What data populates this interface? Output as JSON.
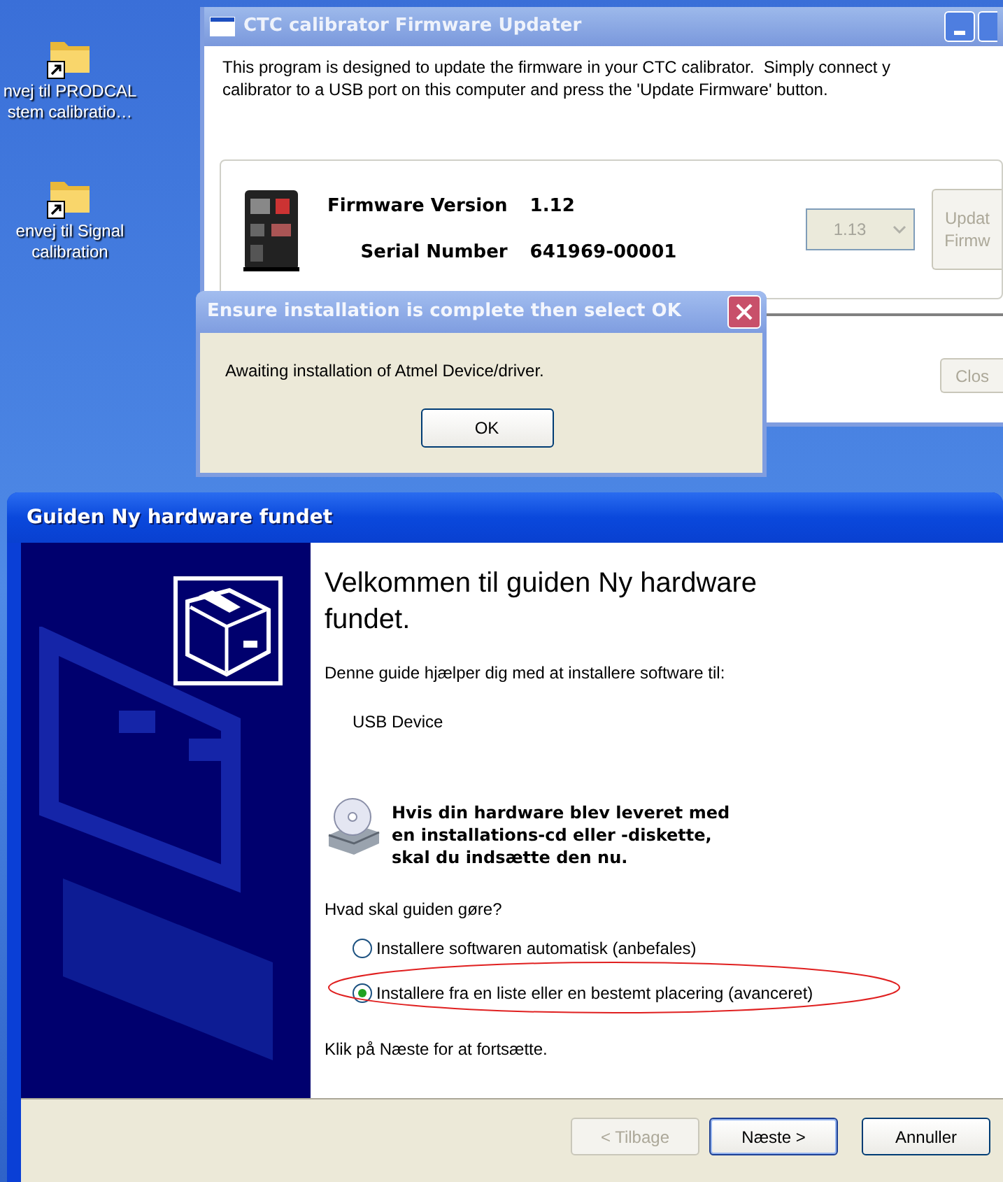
{
  "desktop_icons": [
    {
      "label_lines": [
        "nvej til PRODCAL",
        "stem calibratio…"
      ]
    },
    {
      "label_lines": [
        "envej til Signal",
        "calibration"
      ]
    }
  ],
  "updater_window": {
    "title": "CTC calibrator Firmware Updater",
    "intro_lines": [
      "This program is designed to update the firmware in your CTC calibrator.  Simply connect y",
      "calibrator to a USB port on this computer and press the 'Update Firmware' button."
    ],
    "firmware_version_label": "Firmware Version",
    "firmware_version": "1.12",
    "serial_number_label": "Serial Number",
    "serial_number": "641969-00001",
    "version_select": {
      "value": "1.13",
      "disabled": true
    },
    "update_button": {
      "label_lines": [
        "Updat",
        "Firmw"
      ],
      "disabled": true
    },
    "close_button": {
      "label": "Clos",
      "disabled": true
    }
  },
  "message_dialog": {
    "title": "Ensure installation is complete then select OK",
    "message": "Awaiting installation of Atmel Device/driver.",
    "ok_button": "OK"
  },
  "wizard": {
    "title": "Guiden Ny hardware fundet",
    "heading": "Velkommen til guiden Ny hardware fundet.",
    "intro": "Denne guide hjælper dig med at installere software til:",
    "device": "USB Device",
    "cd_notice_lines": [
      "Hvis din hardware blev leveret med",
      "en installations-cd eller -diskette,",
      "skal du indsætte den nu."
    ],
    "question": "Hvad skal guiden gøre?",
    "options": [
      {
        "label": "Installere softwaren automatisk (anbefales)",
        "selected": false
      },
      {
        "label": "Installere fra en liste eller en bestemt placering (avanceret)",
        "selected": true
      }
    ],
    "continue_hint": "Klik på Næste for at fortsætte.",
    "buttons": [
      {
        "label": "< Tilbage",
        "disabled": true,
        "default": false
      },
      {
        "label": "Næste >",
        "disabled": false,
        "default": true
      },
      {
        "label": "Annuller",
        "disabled": false,
        "default": false
      }
    ]
  }
}
